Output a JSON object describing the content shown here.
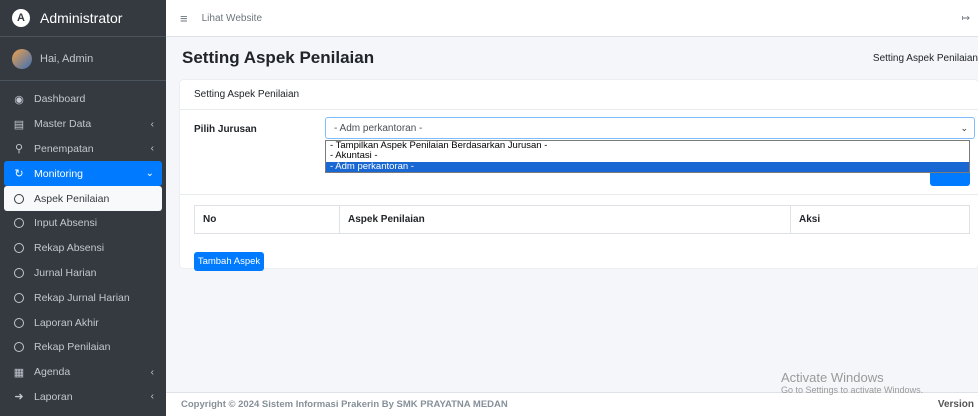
{
  "brand": {
    "title": "Administrator",
    "logo_letter": "A"
  },
  "user": {
    "greeting": "Hai, Admin"
  },
  "sidebar": {
    "items": [
      {
        "label": "Dashboard",
        "icon": "tachometer-icon"
      },
      {
        "label": "Master Data",
        "icon": "table-icon",
        "chevron": "‹"
      },
      {
        "label": "Penempatan",
        "icon": "link-icon",
        "chevron": "‹"
      },
      {
        "label": "Monitoring",
        "icon": "refresh-icon",
        "chevron": "⌄"
      }
    ],
    "sub_items": [
      {
        "label": "Aspek Penilaian"
      },
      {
        "label": "Input Absensi"
      },
      {
        "label": "Rekap Absensi"
      },
      {
        "label": "Jurnal Harian"
      },
      {
        "label": "Rekap Jurnal Harian"
      },
      {
        "label": "Laporan Akhir"
      },
      {
        "label": "Rekap Penilaian"
      }
    ],
    "bottom_items": [
      {
        "label": "Agenda",
        "icon": "calendar-icon",
        "chevron": "‹"
      },
      {
        "label": "Laporan",
        "icon": "sign-in-icon",
        "chevron": "‹"
      }
    ]
  },
  "topbar": {
    "link": "Lihat Website",
    "menu_glyph": "≡",
    "logout_glyph": "↦"
  },
  "page": {
    "title": "Setting Aspek Penilaian",
    "breadcrumb": "Setting Aspek Penilaian"
  },
  "card": {
    "header": "Setting Aspek Penilaian"
  },
  "form": {
    "label": "Pilih Jurusan",
    "selected": "- Adm perkantoran -",
    "options": [
      "- Tampilkan Aspek Penilaian Berdasarkan Jurusan -",
      "- Akuntasi -",
      "- Adm perkantoran -"
    ]
  },
  "table": {
    "columns": [
      "No",
      "Aspek Penilaian",
      "Aksi"
    ]
  },
  "buttons": {
    "add": "Tambah Aspek"
  },
  "footer": {
    "copyright": "Copyright © 2024 Sistem Informasi Prakerin By SMK PRAYATNA MEDAN",
    "version": "Version"
  },
  "watermark": {
    "line1": "Activate Windows",
    "line2": "Go to Settings to activate Windows."
  },
  "colors": {
    "sidebar": "#343a40",
    "primary": "#007bff",
    "select_highlight": "#1967d2"
  }
}
